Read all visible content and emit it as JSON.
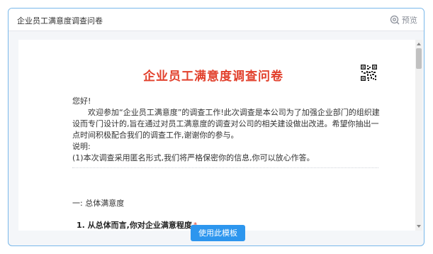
{
  "dialog": {
    "title": "企业员工满意度调查问卷",
    "preview_label": "预览",
    "use_template_label": "使用此模板"
  },
  "survey": {
    "title": "企业员工满意度调查问卷",
    "greeting": "您好!",
    "intro": "欢迎参加“企业员工满意度”的调查工作!此次调查是本公司为了加强企业部门的组织建设而专门设计的,旨在通过对员工满意度的调查对公司的相关建设做出改进。希望你抽出一点时间积极配合我们的调查工作,谢谢你的参与。",
    "note_label": "说明:",
    "note": "(1)本次调查采用匿名形式,我们将严格保密你的信息,你可以放心作答。",
    "section": "一: 总体满意度",
    "question_1": "1. 从总体而言,你对企业满意程度",
    "required_mark": "*"
  },
  "colors": {
    "accent": "#2d96ee",
    "title_red": "#e2412d",
    "border": "#79b8ea"
  },
  "icons": {
    "preview": "eye-preview-icon",
    "qr": "qr-code-icon"
  }
}
